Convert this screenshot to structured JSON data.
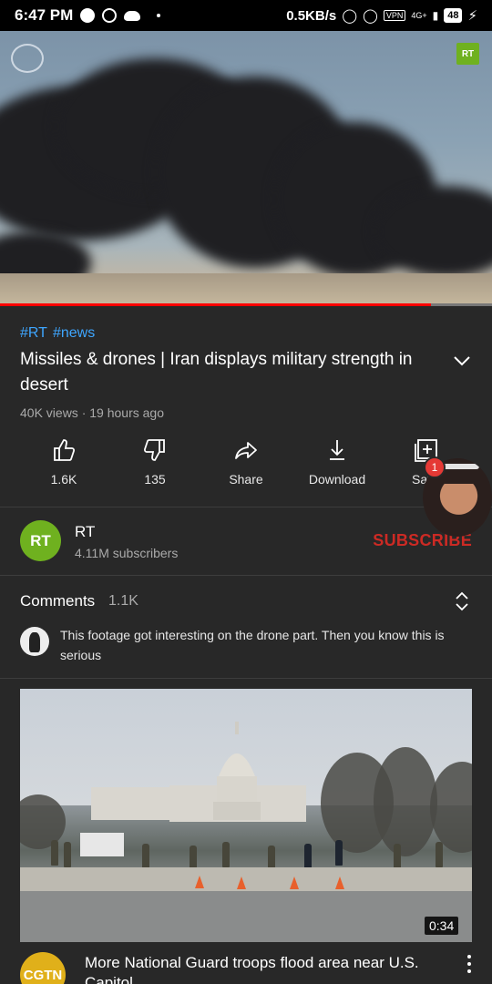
{
  "status_bar": {
    "time": "6:47 PM",
    "speed": "0.5KB/s",
    "vpn": "VPN",
    "network": "4G+",
    "battery": "48"
  },
  "video": {
    "channel_badge": "RT",
    "progress": 0.875
  },
  "info": {
    "hashtags": [
      "#RT",
      "#news"
    ],
    "title": "Missiles & drones | Iran displays military strength in desert",
    "meta": "40K views · 19 hours ago"
  },
  "actions": [
    {
      "label": "1.6K",
      "icon": "thumb-up-icon"
    },
    {
      "label": "135",
      "icon": "thumb-down-icon"
    },
    {
      "label": "Share",
      "icon": "share-icon"
    },
    {
      "label": "Download",
      "icon": "download-icon"
    },
    {
      "label": "Save",
      "icon": "save-playlist-icon"
    }
  ],
  "channel": {
    "avatar_text": "RT",
    "name": "RT",
    "subscribers": "4.11M subscribers",
    "subscribe_label": "SUBSCRIBE"
  },
  "bubble": {
    "badge": "1"
  },
  "comments": {
    "label": "Comments",
    "count": "1.1K",
    "top_comment": "This footage got interesting on the drone part. Then you know this is serious"
  },
  "related": {
    "duration": "0:34",
    "avatar_text": "CGTN",
    "title": "More National Guard troops flood area near U.S. Capitol"
  },
  "colors": {
    "accent_red": "#ff0000",
    "subscribe_red": "#cc2a24",
    "link_blue": "#3ea6ff",
    "rt_green": "#6fb11f",
    "background": "#282828"
  }
}
